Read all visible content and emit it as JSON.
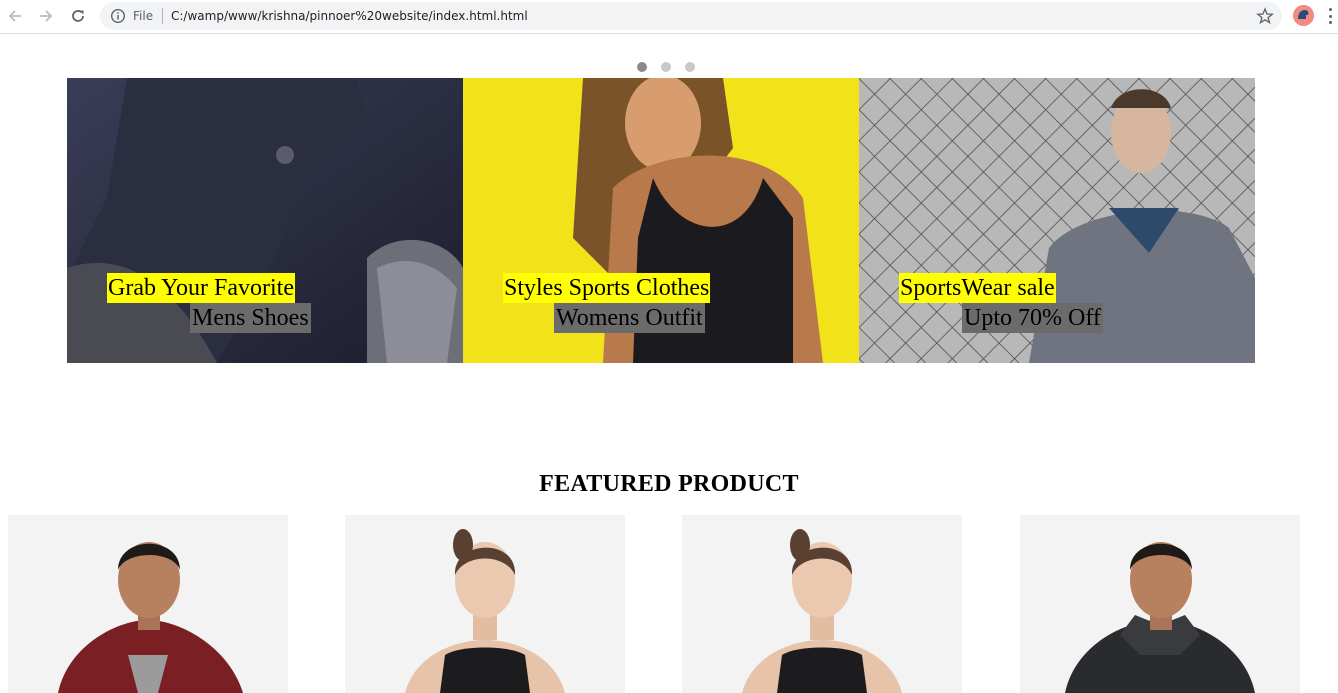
{
  "browser": {
    "file_label": "File",
    "url": "C:/wamp/www/krishna/pinnoer%20website/index.html.html"
  },
  "carousel": {
    "indicator_count": 3,
    "active_index": 0
  },
  "slides": [
    {
      "headline": "Grab Your Favorite",
      "subline": "Mens Shoes"
    },
    {
      "headline": "Styles Sports Clothes",
      "subline": "Womens Outfit"
    },
    {
      "headline": "SportsWear sale",
      "subline": "Upto 70% Off"
    }
  ],
  "featured": {
    "title": "FEATURED PRODUCT"
  },
  "colors": {
    "headline_highlight": "#ffff00",
    "subline_highlight": "#6b6b6b",
    "slide_2_background": "#f2e21a",
    "card_background": "#f3f3f3"
  }
}
